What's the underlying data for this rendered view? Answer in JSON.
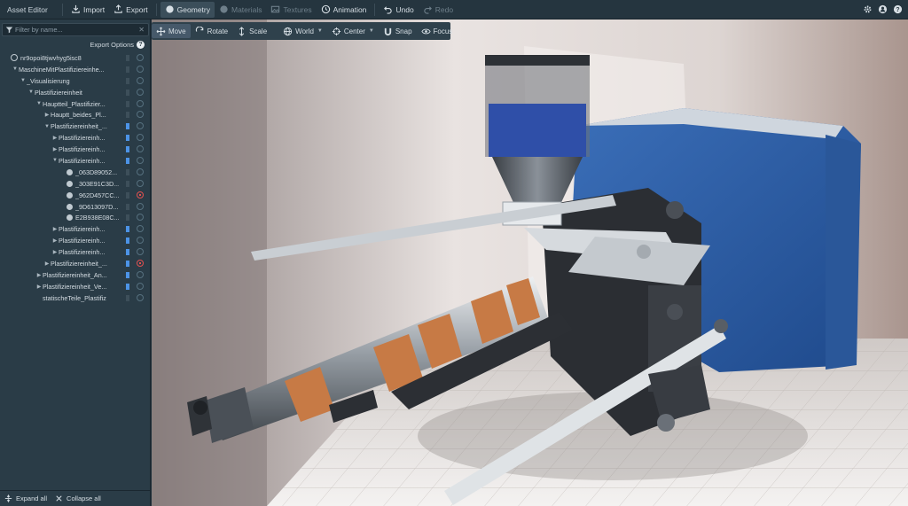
{
  "app": {
    "title": "Asset Editor"
  },
  "toolbar": {
    "import": "Import",
    "export": "Export",
    "tabs": [
      {
        "label": "Geometry",
        "active": true
      },
      {
        "label": "Materials",
        "active": false
      },
      {
        "label": "Textures",
        "active": false
      },
      {
        "label": "Animation",
        "active": false
      }
    ],
    "undo": "Undo",
    "redo": "Redo"
  },
  "topright_icons": [
    "gear-icon",
    "user-icon",
    "help-icon"
  ],
  "sidebar": {
    "filter_placeholder": "Filter by name...",
    "export_options": "Export Options",
    "help_glyph": "?",
    "expand_all": "Expand all",
    "collapse_all": "Collapse all",
    "tree": [
      {
        "label": "nr9opoi8tjwvhyg5isc8",
        "depth": 0,
        "arrow": "",
        "icon": "globe",
        "bookmark": false,
        "hidden": false
      },
      {
        "label": "MaschineMitPlastifiziereinhe...",
        "depth": 1,
        "arrow": "down",
        "icon": "",
        "bookmark": false,
        "hidden": false
      },
      {
        "label": "_Visualisierung",
        "depth": 2,
        "arrow": "down",
        "icon": "",
        "bookmark": false,
        "hidden": false
      },
      {
        "label": "Plastifiziereinheit",
        "depth": 3,
        "arrow": "down",
        "icon": "",
        "bookmark": false,
        "hidden": false
      },
      {
        "label": "Hauptteil_Plastifizier...",
        "depth": 4,
        "arrow": "down",
        "icon": "",
        "bookmark": false,
        "hidden": false
      },
      {
        "label": "Hauptt_beides_Pl...",
        "depth": 5,
        "arrow": "right",
        "icon": "",
        "bookmark": false,
        "hidden": false
      },
      {
        "label": "Plastifiziereinheit_...",
        "depth": 5,
        "arrow": "down",
        "icon": "",
        "bookmark": true,
        "hidden": false
      },
      {
        "label": "Plastifiziereinh...",
        "depth": 6,
        "arrow": "right",
        "icon": "",
        "bookmark": true,
        "hidden": false
      },
      {
        "label": "Plastifiziereinh...",
        "depth": 6,
        "arrow": "right",
        "icon": "",
        "bookmark": true,
        "hidden": false
      },
      {
        "label": "Plastifiziereinh...",
        "depth": 6,
        "arrow": "down",
        "icon": "",
        "bookmark": true,
        "hidden": false
      },
      {
        "label": "_063D89052...",
        "depth": 7,
        "arrow": "",
        "icon": "gear",
        "bookmark": false,
        "hidden": false
      },
      {
        "label": "_303E91C3D...",
        "depth": 7,
        "arrow": "",
        "icon": "gear",
        "bookmark": false,
        "hidden": false
      },
      {
        "label": "_962D457CC...",
        "depth": 7,
        "arrow": "",
        "icon": "gear",
        "bookmark": false,
        "hidden": true
      },
      {
        "label": "_9D613097D...",
        "depth": 7,
        "arrow": "",
        "icon": "gear",
        "bookmark": false,
        "hidden": false
      },
      {
        "label": "E2B938E08C...",
        "depth": 7,
        "arrow": "",
        "icon": "gear",
        "bookmark": false,
        "hidden": false
      },
      {
        "label": "Plastifiziereinh...",
        "depth": 6,
        "arrow": "right",
        "icon": "",
        "bookmark": true,
        "hidden": false
      },
      {
        "label": "Plastifiziereinh...",
        "depth": 6,
        "arrow": "right",
        "icon": "",
        "bookmark": true,
        "hidden": false
      },
      {
        "label": "Plastifiziereinh...",
        "depth": 6,
        "arrow": "right",
        "icon": "",
        "bookmark": true,
        "hidden": false
      },
      {
        "label": "Plastifiziereinheit_...",
        "depth": 5,
        "arrow": "right",
        "icon": "",
        "bookmark": true,
        "hidden": true
      },
      {
        "label": "Plastifiziereinheit_An...",
        "depth": 4,
        "arrow": "right",
        "icon": "",
        "bookmark": true,
        "hidden": false
      },
      {
        "label": "Plastifiziereinheit_Ve...",
        "depth": 4,
        "arrow": "right",
        "icon": "",
        "bookmark": true,
        "hidden": false
      },
      {
        "label": "statischeTeile_Plastifiz",
        "depth": 4,
        "arrow": "",
        "icon": "",
        "bookmark": false,
        "hidden": false
      }
    ]
  },
  "viewport_toolbar": {
    "move": "Move",
    "rotate": "Rotate",
    "scale": "Scale",
    "world": "World",
    "center": "Center",
    "snap": "Snap",
    "focus": "Focus"
  },
  "colors": {
    "accent": "#4c93e6",
    "hidden": "#e05050",
    "panel": "#2a3c47",
    "machine_blue": "#2e5fa8",
    "copper": "#c77a45"
  }
}
